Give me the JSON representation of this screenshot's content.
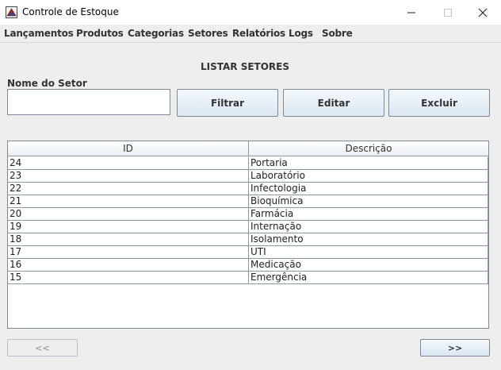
{
  "window": {
    "title": "Controle de Estoque"
  },
  "menu": [
    "Lançamentos",
    "Produtos",
    "Categorias",
    "Setores",
    "Relatórios",
    "Logs",
    "Sobre"
  ],
  "page": {
    "title": "LISTAR SETORES"
  },
  "filter": {
    "label": "Nome do Setor",
    "value": ""
  },
  "buttons": {
    "filter": "Filtrar",
    "edit": "Editar",
    "delete": "Excluir",
    "prev": "<<",
    "next": ">>"
  },
  "table": {
    "headers": [
      "ID",
      "Descrição"
    ],
    "rows": [
      [
        "24",
        "Portaria"
      ],
      [
        "23",
        "Laboratório"
      ],
      [
        "22",
        "Infectologia"
      ],
      [
        "21",
        "Bioquímica"
      ],
      [
        "20",
        "Farmácia"
      ],
      [
        "19",
        "Internação"
      ],
      [
        "18",
        "Isolamento"
      ],
      [
        "17",
        "UTI"
      ],
      [
        "16",
        "Medicação"
      ],
      [
        "15",
        "Emergência"
      ]
    ]
  }
}
